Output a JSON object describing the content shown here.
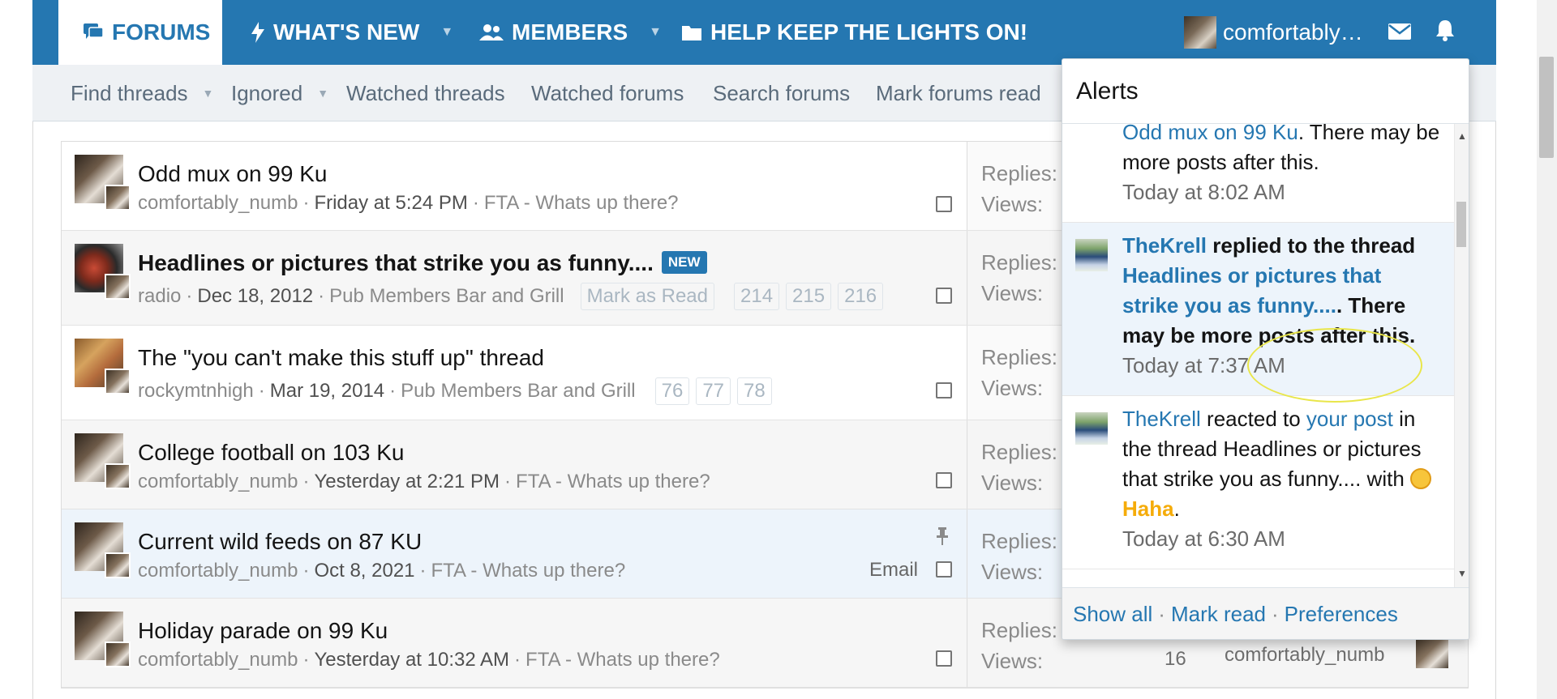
{
  "nav": {
    "tabs": [
      {
        "label": "FORUMS",
        "icon": "forums-icon"
      },
      {
        "label": "WHAT'S NEW",
        "icon": "bolt-icon"
      },
      {
        "label": "MEMBERS",
        "icon": "members-icon"
      },
      {
        "label": "HELP KEEP THE LIGHTS ON!",
        "icon": "folder-icon"
      }
    ],
    "username": "comfortably…"
  },
  "subnav": {
    "find_threads": "Find threads",
    "ignored": "Ignored",
    "watched_threads": "Watched threads",
    "watched_forums": "Watched forums",
    "search_forums": "Search forums",
    "mark_forums_read": "Mark forums read"
  },
  "threads": [
    {
      "title": "Odd mux on 99 Ku",
      "author": "comfortably_numb",
      "date": "Friday at 5:24 PM",
      "forum": "FTA - Whats up there?",
      "replies_label": "Replies:",
      "views_label": "Views:"
    },
    {
      "title": "Headlines or pictures that strike you as funny....",
      "badge": "NEW",
      "author": "radio",
      "date": "Dec 18, 2012",
      "forum": "Pub Members Bar and Grill",
      "mark_as_read": "Mark as Read",
      "pages": [
        "214",
        "215",
        "216"
      ],
      "replies_label": "Replies:",
      "views_label": "Views:"
    },
    {
      "title": "The \"you can't make this stuff up\" thread",
      "author": "rockymtnhigh",
      "date": "Mar 19, 2014",
      "forum": "Pub Members Bar and Grill",
      "pages": [
        "76",
        "77",
        "78"
      ],
      "replies_label": "Replies:",
      "views_label": "Views:"
    },
    {
      "title": "College football on 103 Ku",
      "author": "comfortably_numb",
      "date": "Yesterday at 2:21 PM",
      "forum": "FTA - Whats up there?",
      "replies_label": "Replies:",
      "views_label": "Views:"
    },
    {
      "title": "Current wild feeds on 87 KU",
      "author": "comfortably_numb",
      "date": "Oct 8, 2021",
      "forum": "FTA - Whats up there?",
      "email": "Email",
      "replies_label": "Replies:",
      "views_label": "Views:"
    },
    {
      "title": "Holiday parade on 99 Ku",
      "author": "comfortably_numb",
      "date": "Yesterday at 10:32 AM",
      "forum": "FTA - Whats up there?",
      "replies_label": "Replies:",
      "views_label": "Views:",
      "views": "16",
      "last_poster": "comfortably_numb"
    }
  ],
  "alerts": {
    "title": "Alerts",
    "items": [
      {
        "link": "Odd mux on 99 Ku",
        "text": ". There may be more posts after this.",
        "time": "Today at 8:02 AM"
      },
      {
        "user": "TheKrell",
        "text1": " replied to the thread ",
        "link": "Headlines or pictures that strike you as funny....",
        "text2": ". There may be more posts after this.",
        "time": "Today at 7:37 AM"
      },
      {
        "user": "TheKrell",
        "text1": " reacted to ",
        "link": "your post",
        "text2": " in the thread Headlines or pictures that strike you as funny.... with ",
        "reaction": "Haha",
        "text3": ".",
        "time": "Today at 6:30 AM"
      }
    ],
    "footer": {
      "show_all": "Show all",
      "mark_read": "Mark read",
      "preferences": "Preferences"
    }
  },
  "colors": {
    "brand": "#2577b1",
    "haha": "#f5ac0a",
    "annotation": "#e9e64a"
  }
}
